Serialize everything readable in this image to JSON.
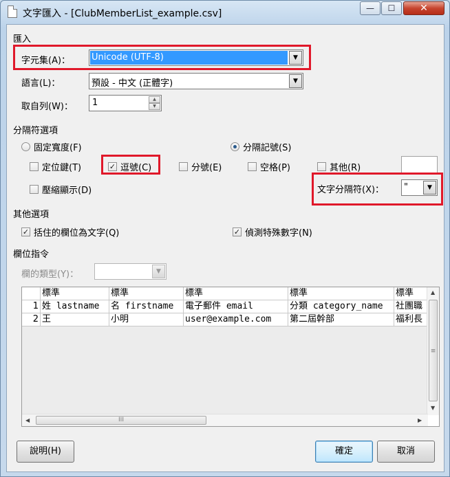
{
  "window": {
    "title": "文字匯入 - [ClubMemberList_example.csv]",
    "minimize_glyph": "—",
    "maximize_glyph": "☐",
    "close_glyph": "✕"
  },
  "import": {
    "section_title": "匯入",
    "charset_label": "字元集(A)：",
    "charset_value": "Unicode (UTF-8)",
    "language_label": "語言(L)：",
    "language_value": "預設 - 中文 (正體字)",
    "from_row_label": "取自列(W)：",
    "from_row_value": "1"
  },
  "separator": {
    "section_title": "分隔符選項",
    "fixed_width_label": "固定寬度(F)",
    "separated_label": "分隔記號(S)",
    "tab_label": "定位鍵(T)",
    "comma_label": "逗號(C)",
    "semicolon_label": "分號(E)",
    "space_label": "空格(P)",
    "other_label": "其他(R)",
    "merge_label": "壓縮顯示(D)",
    "text_delimiter_label": "文字分隔符(X)：",
    "text_delimiter_value": "\"",
    "fixed_width_selected": false,
    "separated_selected": true,
    "tab_checked": false,
    "comma_checked": true,
    "semicolon_checked": false,
    "space_checked": false,
    "other_checked": false,
    "merge_checked": false
  },
  "other_options": {
    "section_title": "其他選項",
    "quoted_as_text_label": "括住的欄位為文字(Q)",
    "detect_special_numbers_label": "偵測特殊數字(N)",
    "quoted_as_text_checked": true,
    "detect_special_numbers_checked": true
  },
  "fields": {
    "section_title": "欄位指令",
    "column_type_label": "欄的類型(Y)：",
    "column_type_value": ""
  },
  "preview": {
    "headers": [
      "標準",
      "標準",
      "標準",
      "標準",
      "標準"
    ],
    "rows": [
      {
        "num": "1",
        "cells": [
          "姓 lastname",
          "名 firstname",
          "電子郵件 email",
          "分類 category_name",
          "社團職"
        ]
      },
      {
        "num": "2",
        "cells": [
          "王",
          "小明",
          "user@example.com",
          "第二屆幹部",
          "福利長"
        ]
      }
    ],
    "hscroll_grip": "III",
    "vscroll_grip": "≡"
  },
  "buttons": {
    "help": "說明(H)",
    "ok": "確定",
    "cancel": "取消"
  },
  "colors": {
    "highlight": "#e0182a",
    "selection": "#3399ff"
  }
}
